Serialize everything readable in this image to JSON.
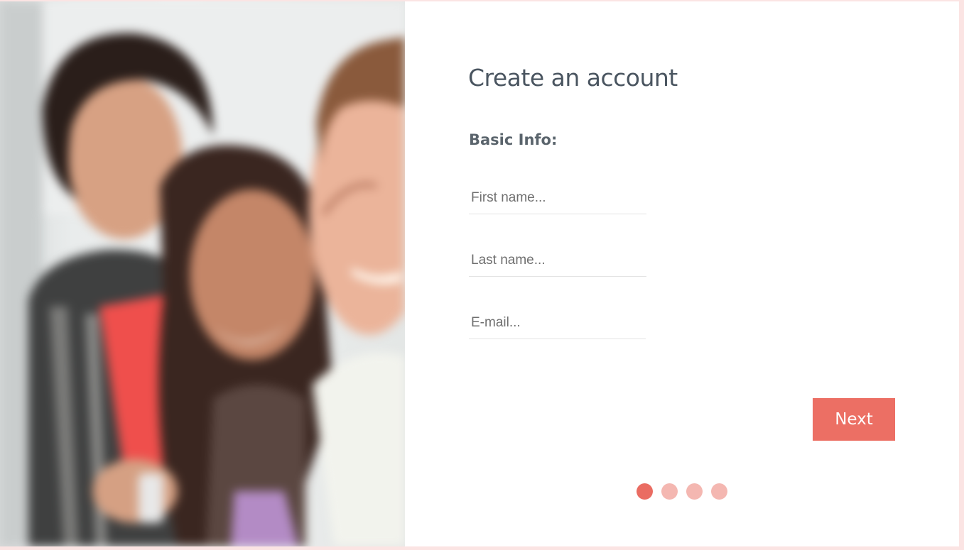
{
  "photo": {
    "description_icon": "people-photo"
  },
  "form": {
    "title": "Create an account",
    "section_label": "Basic Info:",
    "fields": {
      "first_name": {
        "placeholder": "First name...",
        "value": ""
      },
      "last_name": {
        "placeholder": "Last name...",
        "value": ""
      },
      "email": {
        "placeholder": "E-mail...",
        "value": ""
      }
    },
    "next_label": "Next",
    "steps": {
      "current": 1,
      "total": 4
    }
  },
  "colors": {
    "accent": "#ec6f64",
    "step_active": "#ea6c62",
    "step_inactive": "#f4b7b1",
    "title_text": "#4a5560",
    "page_border": "#fbe4e3"
  }
}
